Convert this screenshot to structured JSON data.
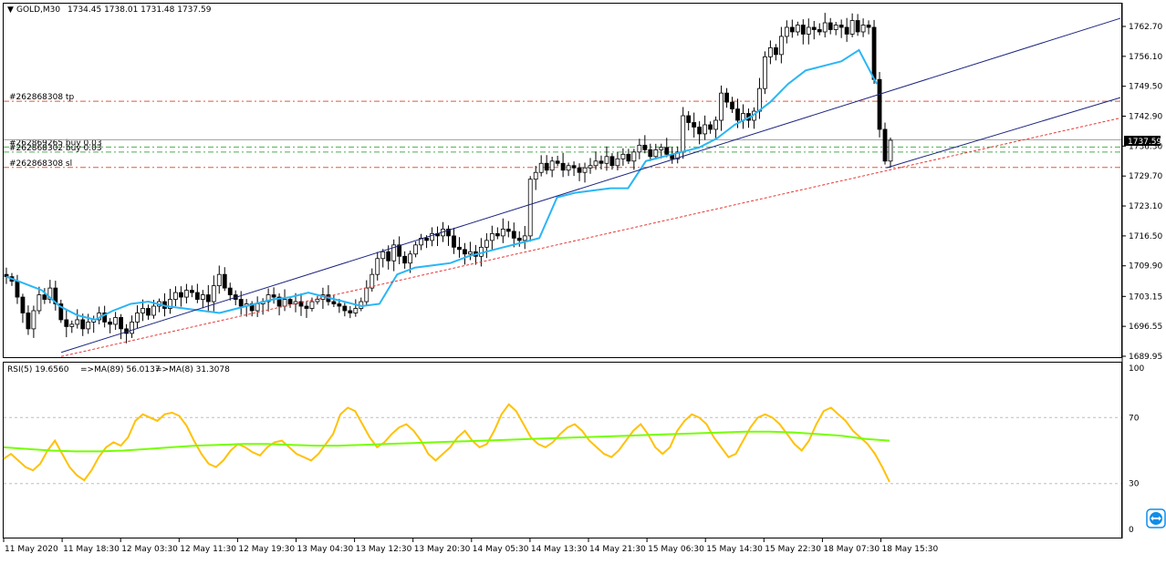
{
  "header": {
    "symbol": "GOLD,M30",
    "ohlc": "1734.45 1738.01 1731.48 1737.59"
  },
  "price_tag": "1737.59",
  "order_lines": [
    {
      "label": "#262868308 tp",
      "price": 1746.2,
      "color": "#e05a3a",
      "style": "dashdot"
    },
    {
      "label": "#262869265 buy 0.03",
      "price": 1736.1,
      "color": "#4caf50",
      "style": "dashdot"
    },
    {
      "label": "#262868302 buy 0.03",
      "price": 1735.0,
      "color": "#4caf50",
      "style": "dashdot"
    },
    {
      "label": "#262868308 sl",
      "price": 1731.6,
      "color": "#e05a3a",
      "style": "dashdot"
    }
  ],
  "rsi_header": {
    "name": "RSI(5) 19.6560",
    "ma89": "=>MA(89) 56.0137",
    "ma8": "=>MA(8) 31.3078"
  },
  "time_labels": [
    "11 May 2020",
    "11 May 18:30",
    "12 May 03:30",
    "12 May 11:30",
    "12 May 19:30",
    "13 May 04:30",
    "13 May 12:30",
    "13 May 20:30",
    "14 May 05:30",
    "14 May 13:30",
    "14 May 21:30",
    "15 May 06:30",
    "15 May 14:30",
    "15 May 22:30",
    "18 May 07:30",
    "18 May 15:30"
  ],
  "price_axis_labels": [
    "1762.70",
    "1756.10",
    "1749.50",
    "1742.90",
    "1736.30",
    "1729.70",
    "1723.10",
    "1716.50",
    "1709.90",
    "1703.15",
    "1696.55",
    "1689.95"
  ],
  "rsi_axis_labels": [
    "100",
    "70",
    "30",
    "0"
  ],
  "colors": {
    "candle": "#000000",
    "signal_line": "#29b6f6",
    "channel": "#1a237e",
    "trend_dashed": "#e53935",
    "rsi": "#ffc107",
    "rsi_ma": "#76ff03",
    "grid_level": "#bdbdbd"
  },
  "chart_data": [
    {
      "type": "candlestick",
      "title": "GOLD,M30",
      "ylim": [
        1689.95,
        1766.0
      ],
      "y_ticks": [
        1762.7,
        1756.1,
        1749.5,
        1742.9,
        1736.3,
        1729.7,
        1723.1,
        1716.5,
        1709.9,
        1703.15,
        1696.55,
        1689.95
      ],
      "current_price": 1737.59,
      "close_path": [
        1707.5,
        1706.5,
        1703.0,
        1699.5,
        1696.0,
        1700.0,
        1703.5,
        1702.5,
        1705.0,
        1701.5,
        1698.0,
        1696.5,
        1697.0,
        1698.0,
        1696.0,
        1697.5,
        1698.0,
        1699.5,
        1697.5,
        1697.0,
        1698.5,
        1696.0,
        1695.0,
        1697.5,
        1699.5,
        1700.5,
        1699.0,
        1701.0,
        1702.0,
        1700.5,
        1702.5,
        1704.0,
        1703.0,
        1704.5,
        1704.0,
        1702.5,
        1703.5,
        1702.0,
        1705.5,
        1708.0,
        1705.0,
        1703.5,
        1702.5,
        1701.0,
        1701.5,
        1700.0,
        1701.5,
        1702.0,
        1703.5,
        1703.0,
        1701.0,
        1702.5,
        1701.5,
        1702.0,
        1701.0,
        1700.5,
        1702.0,
        1702.5,
        1703.5,
        1702.0,
        1701.5,
        1701.0,
        1700.0,
        1699.5,
        1700.5,
        1702.0,
        1705.0,
        1708.0,
        1711.5,
        1713.0,
        1711.0,
        1714.5,
        1712.0,
        1710.5,
        1712.5,
        1714.5,
        1716.0,
        1715.5,
        1717.0,
        1716.5,
        1718.0,
        1716.5,
        1714.0,
        1713.5,
        1712.5,
        1713.0,
        1712.0,
        1714.0,
        1715.5,
        1717.0,
        1716.5,
        1718.0,
        1717.5,
        1716.0,
        1715.5,
        1716.5,
        1729.0,
        1730.5,
        1732.5,
        1731.0,
        1733.0,
        1732.5,
        1731.0,
        1732.0,
        1731.5,
        1730.5,
        1731.5,
        1732.0,
        1733.0,
        1732.5,
        1734.0,
        1732.0,
        1733.5,
        1734.5,
        1733.0,
        1735.0,
        1736.5,
        1735.5,
        1734.0,
        1735.5,
        1736.0,
        1734.5,
        1733.5,
        1735.0,
        1743.0,
        1741.5,
        1740.5,
        1739.0,
        1741.0,
        1740.0,
        1742.0,
        1748.0,
        1746.0,
        1744.5,
        1742.0,
        1743.5,
        1742.0,
        1744.0,
        1749.0,
        1756.0,
        1758.0,
        1756.5,
        1760.5,
        1762.5,
        1761.5,
        1763.0,
        1761.0,
        1762.5,
        1762.0,
        1761.5,
        1763.5,
        1762.0,
        1763.0,
        1762.5,
        1761.0,
        1764.0,
        1761.5,
        1763.0,
        1762.5,
        1751.0,
        1740.0,
        1733.0,
        1737.59
      ],
      "series": [
        {
          "name": "",
          "kind": "signal_step",
          "values": [
            1707.5,
            1706.0,
            1704.5,
            1701.0,
            1699.0,
            1698.0,
            1700.0,
            1701.5,
            1702.0,
            1701.0,
            1700.5,
            1700.0,
            1699.5,
            1700.5,
            1701.5,
            1702.5,
            1703.0,
            1704.0,
            1703.0,
            1702.0,
            1701.0,
            1701.5,
            1708.0,
            1709.5,
            1710.0,
            1710.5,
            1712.0,
            1713.0,
            1714.0,
            1715.0,
            1716.0,
            1725.0,
            1726.0,
            1726.5,
            1727.0,
            1727.0,
            1733.0,
            1734.0,
            1735.0,
            1736.0,
            1738.0,
            1741.0,
            1743.0,
            1746.0,
            1750.0,
            1753.0,
            1754.0,
            1755.0,
            1757.5,
            1750.0
          ]
        },
        {
          "name": "",
          "kind": "channel_upper",
          "from": [
            0.05,
            1690.8
          ],
          "to": [
            1.0,
            1764.5
          ]
        },
        {
          "name": "",
          "kind": "channel_lower",
          "from": [
            0.79,
            1731.5
          ],
          "to": [
            1.0,
            1747.0
          ]
        },
        {
          "name": "",
          "kind": "trend_dashed",
          "from": [
            0.05,
            1689.9
          ],
          "to": [
            1.0,
            1742.5
          ]
        }
      ]
    },
    {
      "type": "line",
      "title": "RSI(5) 19.6560",
      "ylim": [
        0,
        100
      ],
      "levels": [
        70,
        30
      ],
      "series": [
        {
          "name": "RSI(5)",
          "values": [
            45,
            48,
            44,
            40,
            38,
            42,
            50,
            56,
            48,
            40,
            35,
            32,
            38,
            46,
            52,
            55,
            53,
            58,
            68,
            72,
            70,
            68,
            72,
            73,
            71,
            65,
            56,
            48,
            42,
            40,
            44,
            50,
            54,
            52,
            49,
            47,
            52,
            55,
            56,
            52,
            48,
            46,
            44,
            48,
            54,
            60,
            72,
            76,
            74,
            66,
            58,
            52,
            55,
            60,
            64,
            66,
            62,
            56,
            48,
            44,
            48,
            52,
            58,
            62,
            56,
            52,
            54,
            62,
            72,
            78,
            74,
            66,
            58,
            54,
            52,
            55,
            60,
            64,
            66,
            62,
            56,
            52,
            48,
            46,
            50,
            56,
            62,
            66,
            60,
            52,
            48,
            52,
            62,
            68,
            72,
            70,
            66,
            58,
            52,
            46,
            48,
            56,
            64,
            70,
            72,
            70,
            66,
            60,
            54,
            50,
            56,
            66,
            74,
            76,
            72,
            68,
            62,
            58,
            54,
            48,
            40,
            31
          ]
        },
        {
          "name": "MA(89)",
          "values": [
            52,
            51,
            50,
            49.5,
            49.5,
            50,
            51,
            52,
            53,
            53.5,
            54,
            54,
            53.5,
            53,
            53,
            53.5,
            54,
            54.5,
            55,
            55.5,
            56,
            56.5,
            57,
            57.5,
            58,
            58.5,
            59,
            59.5,
            60,
            60.5,
            61,
            61.5,
            61.5,
            61,
            60,
            59,
            57,
            56
          ]
        }
      ]
    }
  ]
}
